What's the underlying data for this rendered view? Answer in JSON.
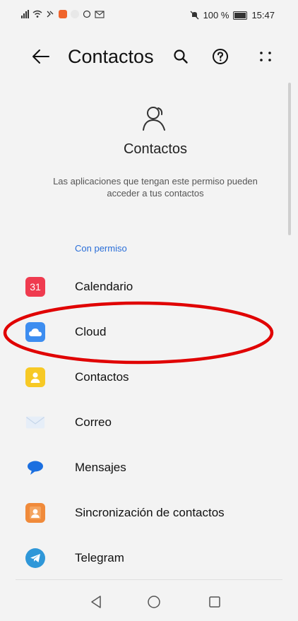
{
  "status_bar": {
    "battery_text": "100 %",
    "time": "15:47"
  },
  "app_bar": {
    "title": "Contactos",
    "back_icon": "arrow-left-icon",
    "search_icon": "search-icon",
    "help_icon": "help-circle-icon",
    "more_icon": "more-dots-icon"
  },
  "header": {
    "icon": "person-icon",
    "title": "Contactos",
    "description": "Las aplicaciones que tengan este permiso pueden acceder a tus contactos"
  },
  "section": {
    "label": "Con permiso"
  },
  "apps": [
    {
      "label": "Calendario",
      "icon": "calendar-icon",
      "icon_text": "31",
      "color": "#ef3b4f"
    },
    {
      "label": "Cloud",
      "icon": "cloud-icon",
      "icon_text": "",
      "color": "#3d8df0"
    },
    {
      "label": "Contactos",
      "icon": "contacts-icon",
      "icon_text": "",
      "color": "#f7c925"
    },
    {
      "label": "Correo",
      "icon": "mail-icon",
      "icon_text": "",
      "color": "#dfeaf6"
    },
    {
      "label": "Mensajes",
      "icon": "message-icon",
      "icon_text": "",
      "color": "#1b6fe0"
    },
    {
      "label": "Sincronización de contactos",
      "icon": "sync-contacts-icon",
      "icon_text": "",
      "color": "#f08a3a"
    },
    {
      "label": "Telegram",
      "icon": "telegram-icon",
      "icon_text": "",
      "color": "#2f97d8"
    }
  ],
  "annotation": {
    "target": "Cloud",
    "color": "#e00000"
  },
  "nav_bar": {
    "back_icon": "nav-back-icon",
    "home_icon": "nav-home-icon",
    "recents_icon": "nav-recents-icon"
  }
}
